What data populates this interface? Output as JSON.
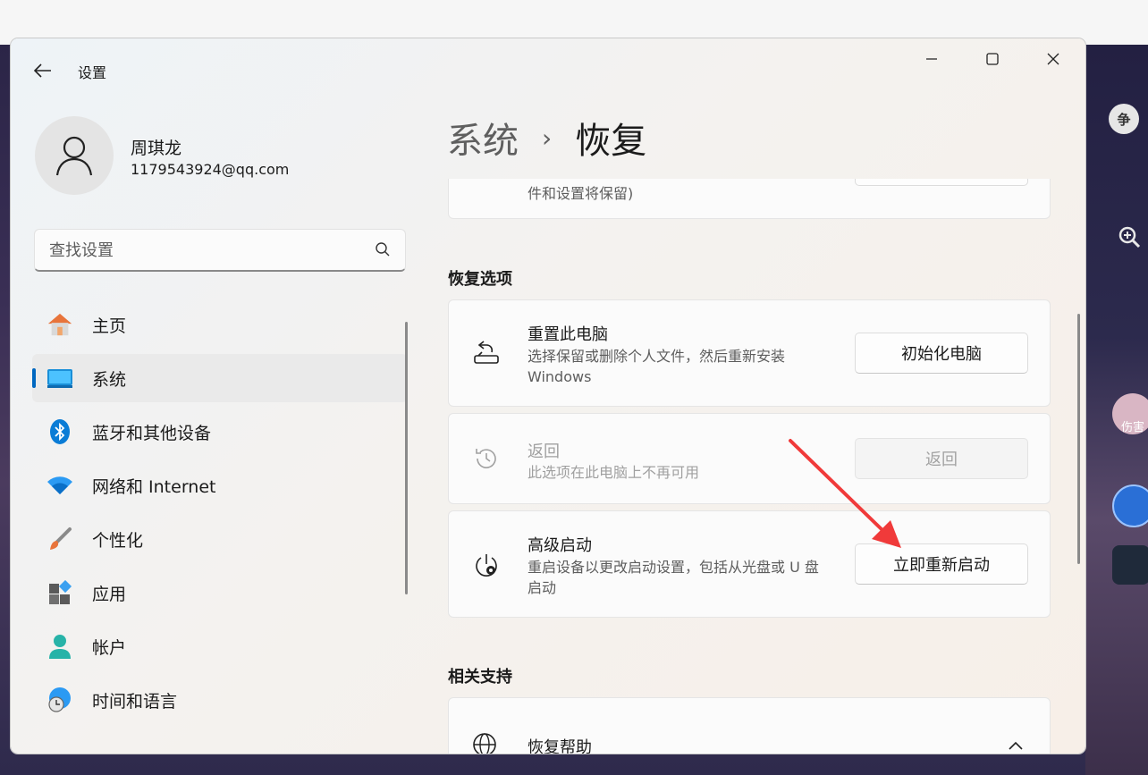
{
  "window": {
    "title": "设置",
    "controls": {
      "minimize": "minimize-icon",
      "maximize": "maximize-icon",
      "close": "close-icon"
    }
  },
  "profile": {
    "name": "周琪龙",
    "email": "1179543924@qq.com"
  },
  "search": {
    "placeholder": "查找设置"
  },
  "nav": {
    "items": [
      {
        "label": "主页",
        "icon": "home-icon",
        "active": false
      },
      {
        "label": "系统",
        "icon": "system-icon",
        "active": true
      },
      {
        "label": "蓝牙和其他设备",
        "icon": "bluetooth-icon",
        "active": false
      },
      {
        "label": "网络和 Internet",
        "icon": "wifi-icon",
        "active": false
      },
      {
        "label": "个性化",
        "icon": "brush-icon",
        "active": false
      },
      {
        "label": "应用",
        "icon": "apps-icon",
        "active": false
      },
      {
        "label": "帐户",
        "icon": "account-icon",
        "active": false
      },
      {
        "label": "时间和语言",
        "icon": "time-language-icon",
        "active": false
      }
    ]
  },
  "breadcrumb": {
    "parent": "系统",
    "separator": "›",
    "current": "恢复"
  },
  "partial_card": {
    "desc": "件和设置将保留)"
  },
  "recovery_options": {
    "heading": "恢复选项",
    "reset": {
      "title": "重置此电脑",
      "desc": "选择保留或删除个人文件，然后重新安装 Windows",
      "button": "初始化电脑"
    },
    "go_back": {
      "title": "返回",
      "desc": "此选项在此电脑上不再可用",
      "button": "返回"
    },
    "advanced_startup": {
      "title": "高级启动",
      "desc": "重启设备以更改启动设置，包括从光盘或 U 盘启动",
      "button": "立即重新启动"
    }
  },
  "related_support": {
    "heading": "相关支持",
    "help": {
      "title": "恢复帮助"
    }
  },
  "game_side": {
    "labels": [
      "争",
      "伤害"
    ]
  },
  "colors": {
    "accent": "#0067c0",
    "annotation_arrow": "#f03a3a"
  }
}
